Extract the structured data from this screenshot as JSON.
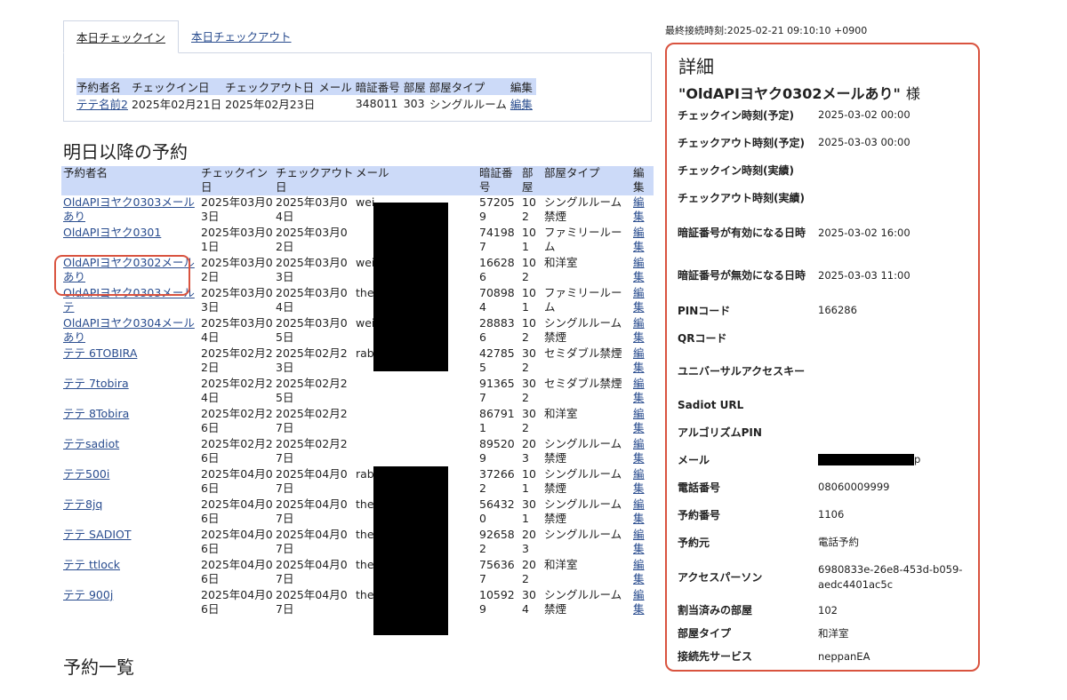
{
  "tabs": {
    "today_checkin": "本日チェックイン",
    "today_checkout": "本日チェックアウト"
  },
  "today_table": {
    "headers": [
      "予約者名",
      "チェックイン日",
      "チェックアウト日",
      "メール",
      "暗証番号",
      "部屋",
      "部屋タイプ",
      "編集"
    ],
    "rows": [
      {
        "name": "テテ名前2",
        "checkin": "2025年02月21日",
        "checkout": "2025年02月23日",
        "mail": "",
        "pin": "348011",
        "room": "303",
        "type": "シングルルーム",
        "edit": "編集"
      }
    ]
  },
  "future": {
    "heading": "明日以降の予約",
    "headers": [
      "予約者名",
      "チェックイン日",
      "チェックアウト日",
      "メール",
      "暗証番号",
      "部屋",
      "部屋タイプ",
      "編集"
    ],
    "rows": [
      {
        "name": "OldAPIヨヤク0303メールあり",
        "checkin": "2025年03月03日",
        "checkout": "2025年03月04日",
        "mail": "wei",
        "pin": "572059",
        "room": "102",
        "type": "シングルルーム禁煙",
        "edit": "編集"
      },
      {
        "name": "OldAPIヨヤク0301",
        "checkin": "2025年03月01日",
        "checkout": "2025年03月02日",
        "mail": "",
        "pin": "741987",
        "room": "101",
        "type": "ファミリールーム",
        "edit": "編集"
      },
      {
        "name": "OldAPIヨヤク0302メールあり",
        "checkin": "2025年03月02日",
        "checkout": "2025年03月03日",
        "mail": "wei",
        "pin": "166286",
        "room": "102",
        "type": "和洋室",
        "edit": "編集"
      },
      {
        "name": "OldAPIヨヤク0303メールテ",
        "checkin": "2025年03月03日",
        "checkout": "2025年03月04日",
        "mail": "thee",
        "pin": "708984",
        "room": "101",
        "type": "ファミリールーム",
        "edit": "編集"
      },
      {
        "name": "OldAPIヨヤク0304メールあり",
        "checkin": "2025年03月04日",
        "checkout": "2025年03月05日",
        "mail": "wei",
        "pin": "288836",
        "room": "102",
        "type": "シングルルーム禁煙",
        "edit": "編集"
      },
      {
        "name": "テテ 6TOBIRA",
        "checkin": "2025年02月22日",
        "checkout": "2025年02月23日",
        "mail": "rabl",
        "pin": "427855",
        "room": "302",
        "type": "セミダブル禁煙",
        "edit": "編集"
      },
      {
        "name": "テテ 7tobira",
        "checkin": "2025年02月24日",
        "checkout": "2025年02月25日",
        "mail": "",
        "pin": "913657",
        "room": "302",
        "type": "セミダブル禁煙",
        "edit": "編集"
      },
      {
        "name": "テテ 8Tobira",
        "checkin": "2025年02月26日",
        "checkout": "2025年02月27日",
        "mail": "",
        "pin": "867911",
        "room": "302",
        "type": "和洋室",
        "edit": "編集"
      },
      {
        "name": "テテsadiot",
        "checkin": "2025年02月26日",
        "checkout": "2025年02月27日",
        "mail": "",
        "pin": "895209",
        "room": "203",
        "type": "シングルルーム禁煙",
        "edit": "編集"
      },
      {
        "name": "テテ500i",
        "checkin": "2025年04月06日",
        "checkout": "2025年04月07日",
        "mail": "rabl",
        "pin": "372662",
        "room": "101",
        "type": "シングルルーム禁煙",
        "edit": "編集"
      },
      {
        "name": "テテ8jq",
        "checkin": "2025年04月06日",
        "checkout": "2025年04月07日",
        "mail": "thee",
        "pin": "564320",
        "room": "301",
        "type": "シングルルーム禁煙",
        "edit": "編集"
      },
      {
        "name": "テテ SADIOT",
        "checkin": "2025年04月06日",
        "checkout": "2025年04月07日",
        "mail": "thee",
        "pin": "926582",
        "room": "203",
        "type": "シングルルーム",
        "edit": "編集"
      },
      {
        "name": "テテ ttlock",
        "checkin": "2025年04月06日",
        "checkout": "2025年04月07日",
        "mail": "thee",
        "pin": "756367",
        "room": "202",
        "type": "和洋室",
        "edit": "編集"
      },
      {
        "name": "テテ 900j",
        "checkin": "2025年04月06日",
        "checkout": "2025年04月07日",
        "mail": "thee",
        "pin": "105929",
        "room": "304",
        "type": "シングルルーム禁煙",
        "edit": "編集"
      }
    ]
  },
  "list_heading": "予約一覧",
  "last_connection": "最終接続時刻:2025-02-21 09:10:10 +0900",
  "detail": {
    "title": "詳細",
    "guest": "\"OldAPIヨヤク0302メールあり\"",
    "suffix": "様",
    "fields": [
      {
        "label": "チェックイン時刻(予定)",
        "value": "2025-03-02 00:00"
      },
      {
        "label": "チェックアウト時刻(予定)",
        "value": "2025-03-03 00:00"
      },
      {
        "label": "チェックイン時刻(実績)",
        "value": ""
      },
      {
        "label": "チェックアウト時刻(実績)",
        "value": ""
      },
      {
        "label": "暗証番号が有効になる日時",
        "value": "2025-03-02 16:00"
      },
      {
        "label": "暗証番号が無効になる日時",
        "value": "2025-03-03 11:00"
      },
      {
        "label": "PINコード",
        "value": "166286"
      },
      {
        "label": "QRコード",
        "value": ""
      },
      {
        "label": "ユニバーサルアクセスキー",
        "value": ""
      },
      {
        "label": "Sadiot URL",
        "value": ""
      },
      {
        "label": "アルゴリズムPIN",
        "value": ""
      },
      {
        "label": "メール",
        "value": "p"
      },
      {
        "label": "電話番号",
        "value": "08060009999"
      },
      {
        "label": "予約番号",
        "value": "1106"
      },
      {
        "label": "予約元",
        "value": "電話予約"
      },
      {
        "label": "アクセスパーソン",
        "value": "6980833e-26e8-453d-b059-aedc4401ac5c"
      },
      {
        "label": "割当済みの部屋",
        "value": "102"
      },
      {
        "label": "部屋タイプ",
        "value": "和洋室"
      },
      {
        "label": "接続先サービス",
        "value": "neppanEA"
      }
    ]
  },
  "colors": {
    "header_bg": "#ccdaf8",
    "link": "#2a4d8f",
    "highlight": "#d9533f"
  }
}
